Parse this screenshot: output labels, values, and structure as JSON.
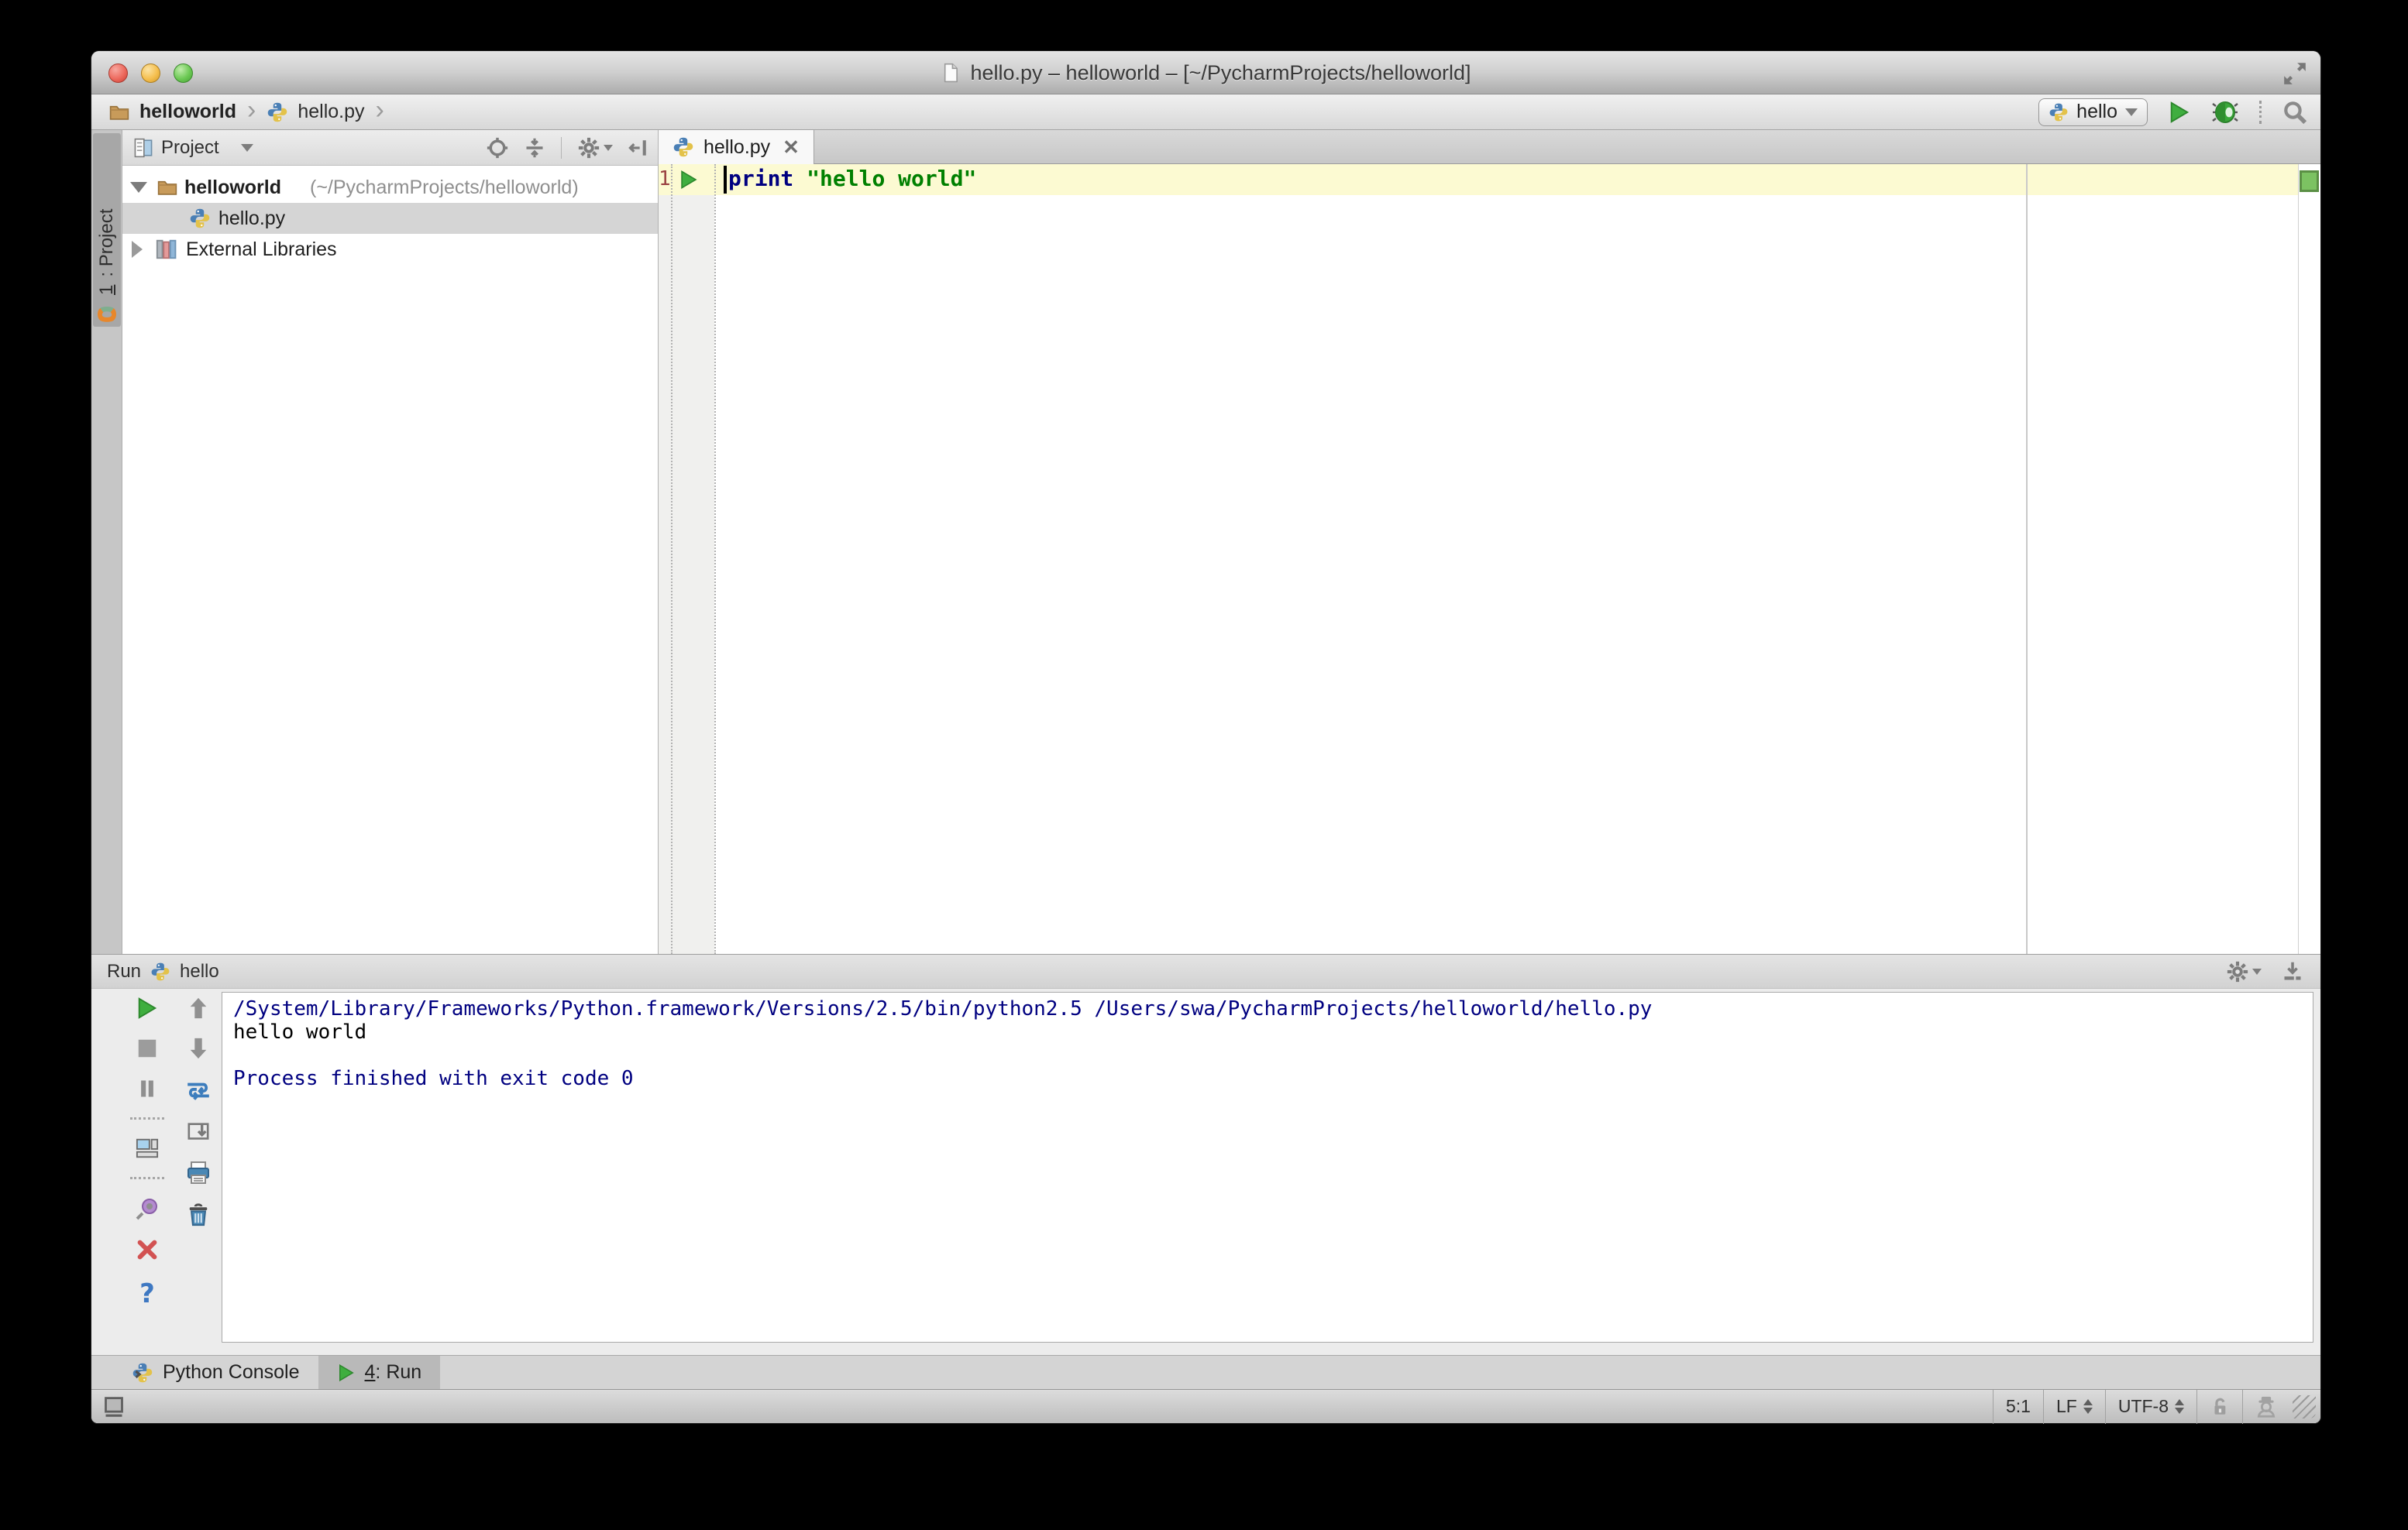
{
  "window": {
    "title": "hello.py – helloworld – [~/PycharmProjects/helloworld]"
  },
  "toolbar": {
    "breadcrumb": {
      "project": "helloworld",
      "file": "hello.py"
    },
    "run_config": {
      "label": "hello"
    }
  },
  "icons": {
    "crumb_chevron": "›",
    "tab_close": "✕",
    "help": "?"
  },
  "project_panel": {
    "stripe_button": {
      "mnemonic": "1",
      "label": ": Project"
    },
    "header": {
      "title": "Project"
    },
    "tree": [
      {
        "name": "helloworld",
        "path": "(~/PycharmProjects/helloworld)"
      },
      {
        "name": "hello.py"
      },
      {
        "name": "External Libraries"
      }
    ]
  },
  "editor": {
    "tab": {
      "label": "hello.py"
    },
    "gutter": {
      "line_number": "1"
    },
    "code": {
      "keyword": "print",
      "string": "\"hello world\""
    }
  },
  "run_panel": {
    "title": "Run",
    "config_label": "hello",
    "console": {
      "lines": [
        {
          "text": "/System/Library/Frameworks/Python.framework/Versions/2.5/bin/python2.5 /Users/swa/PycharmProjects/helloworld/hello.py",
          "kind": "system"
        },
        {
          "text": "hello world",
          "kind": "stdout"
        },
        {
          "text": "",
          "kind": "blank"
        },
        {
          "text": "Process finished with exit code 0",
          "kind": "system"
        }
      ]
    }
  },
  "bottom_bar": {
    "tabs": [
      {
        "label": "Python Console"
      },
      {
        "mnemonic": "4",
        "label": ": Run"
      }
    ]
  },
  "status_bar": {
    "caret_position": "5:1",
    "line_separator": "LF",
    "encoding": "UTF-8"
  },
  "colors": {
    "run_green": "#3fae3f",
    "keyword_blue": "#000080",
    "string_green": "#008000",
    "console_system_blue": "#000080",
    "line_highlight_yellow": "#fcfad2",
    "inactive_selection_gray": "#d5d5d5",
    "error_stripe_ok_green": "#7cc262"
  }
}
